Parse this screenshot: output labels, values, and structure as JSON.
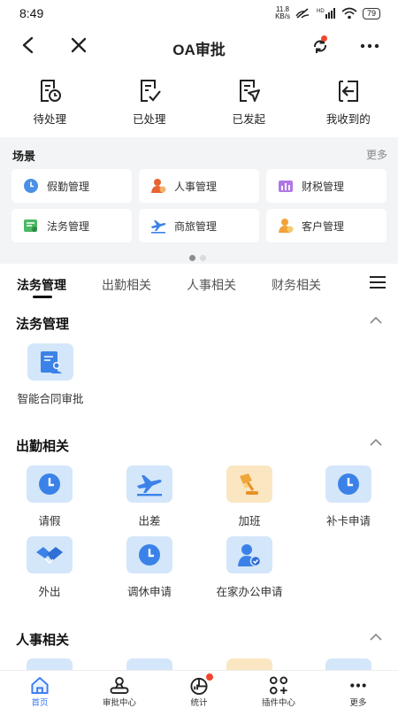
{
  "status_bar": {
    "time": "8:49",
    "net_speed_value": "11.8",
    "net_speed_unit": "KB/s",
    "battery": "79"
  },
  "header": {
    "title": "OA审批"
  },
  "quick_actions": [
    {
      "label": "待处理",
      "icon": "pending-doc-icon"
    },
    {
      "label": "已处理",
      "icon": "processed-doc-icon"
    },
    {
      "label": "已发起",
      "icon": "initiated-doc-icon"
    },
    {
      "label": "我收到的",
      "icon": "received-icon"
    }
  ],
  "scenes": {
    "title": "场景",
    "more": "更多",
    "items": [
      {
        "label": "假勤管理",
        "icon": "clock-icon"
      },
      {
        "label": "人事管理",
        "icon": "person-icon"
      },
      {
        "label": "财税管理",
        "icon": "finance-chart-icon"
      },
      {
        "label": "法务管理",
        "icon": "legal-icon"
      },
      {
        "label": "商旅管理",
        "icon": "plane-icon"
      },
      {
        "label": "客户管理",
        "icon": "customer-icon"
      }
    ],
    "page_count": 2,
    "current_page": 1
  },
  "tabs": [
    "法务管理",
    "出勤相关",
    "人事相关",
    "财务相关"
  ],
  "active_tab": 0,
  "sections": [
    {
      "title": "法务管理",
      "items": [
        {
          "label": "智能合同审批",
          "icon": "contract-icon"
        }
      ]
    },
    {
      "title": "出勤相关",
      "items": [
        {
          "label": "请假",
          "icon": "clock-icon"
        },
        {
          "label": "出差",
          "icon": "plane-icon"
        },
        {
          "label": "加班",
          "icon": "lamp-icon"
        },
        {
          "label": "补卡申请",
          "icon": "clock-icon"
        },
        {
          "label": "外出",
          "icon": "handshake-icon"
        },
        {
          "label": "调休申请",
          "icon": "clock-icon"
        },
        {
          "label": "在家办公申请",
          "icon": "person-check-icon"
        }
      ]
    },
    {
      "title": "人事相关",
      "items": []
    }
  ],
  "bottom_nav": [
    {
      "label": "首页",
      "icon": "home-icon",
      "active": true
    },
    {
      "label": "审批中心",
      "icon": "approval-center-icon",
      "active": false
    },
    {
      "label": "统计",
      "icon": "stats-icon",
      "active": false,
      "badge": true
    },
    {
      "label": "插件中心",
      "icon": "plugin-icon",
      "active": false
    },
    {
      "label": "更多",
      "icon": "more-icon",
      "active": false
    }
  ],
  "colors": {
    "accent": "#3a7af0",
    "badge": "#f0462e",
    "icon_blue": "#3b82e8",
    "icon_bg_blue": "#d4e6fa",
    "icon_bg_orange": "#fbe6c2"
  }
}
